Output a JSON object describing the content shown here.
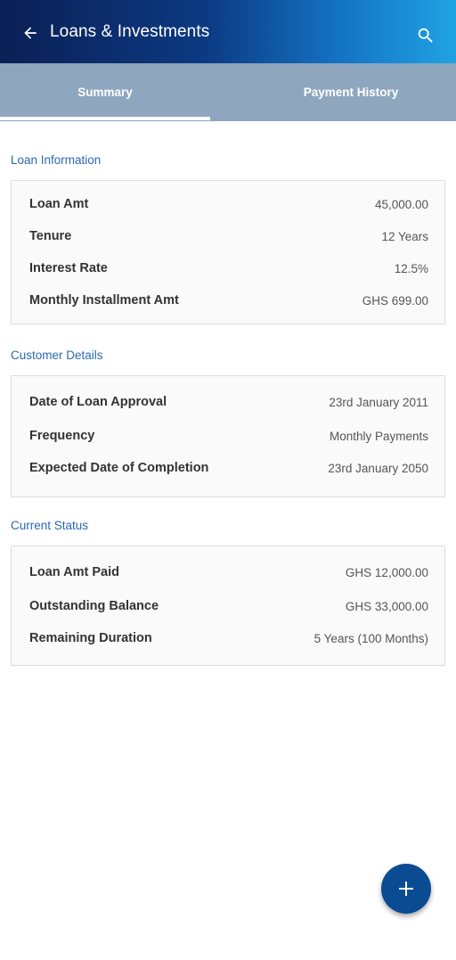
{
  "header": {
    "title": "Loans & Investments",
    "back_icon": "arrow-left-icon",
    "search_icon": "search-icon"
  },
  "tabs": [
    {
      "label": "Summary",
      "active": true
    },
    {
      "label": "Payment History",
      "active": false
    }
  ],
  "sections": {
    "loan_info": {
      "title": "Loan Information",
      "rows": [
        {
          "label": "Loan Amt",
          "value": "45,000.00"
        },
        {
          "label": "Tenure",
          "value": "12 Years"
        },
        {
          "label": "Interest Rate",
          "value": "12.5%"
        },
        {
          "label": "Monthly Installment Amt",
          "value": "GHS 699.00"
        }
      ]
    },
    "customer": {
      "title": "Customer Details",
      "rows": [
        {
          "label": "Date of Loan Approval",
          "value": "23rd January 2011"
        },
        {
          "label": "Frequency",
          "value": "Monthly Payments"
        },
        {
          "label": "Expected Date of Completion",
          "value": "23rd January 2050"
        }
      ]
    },
    "status": {
      "title": "Current Status",
      "rows": [
        {
          "label": "Loan Amt Paid",
          "value": "GHS 12,000.00"
        },
        {
          "label": "Outstanding Balance",
          "value": "GHS 33,000.00"
        },
        {
          "label": "Remaining Duration",
          "value": "5 Years (100 Months)"
        }
      ]
    }
  },
  "fab": {
    "icon": "plus-icon"
  },
  "colors": {
    "accent": "#2b68b5",
    "tab_bar": "#8fa6bf",
    "fab": "#0b4b92"
  }
}
